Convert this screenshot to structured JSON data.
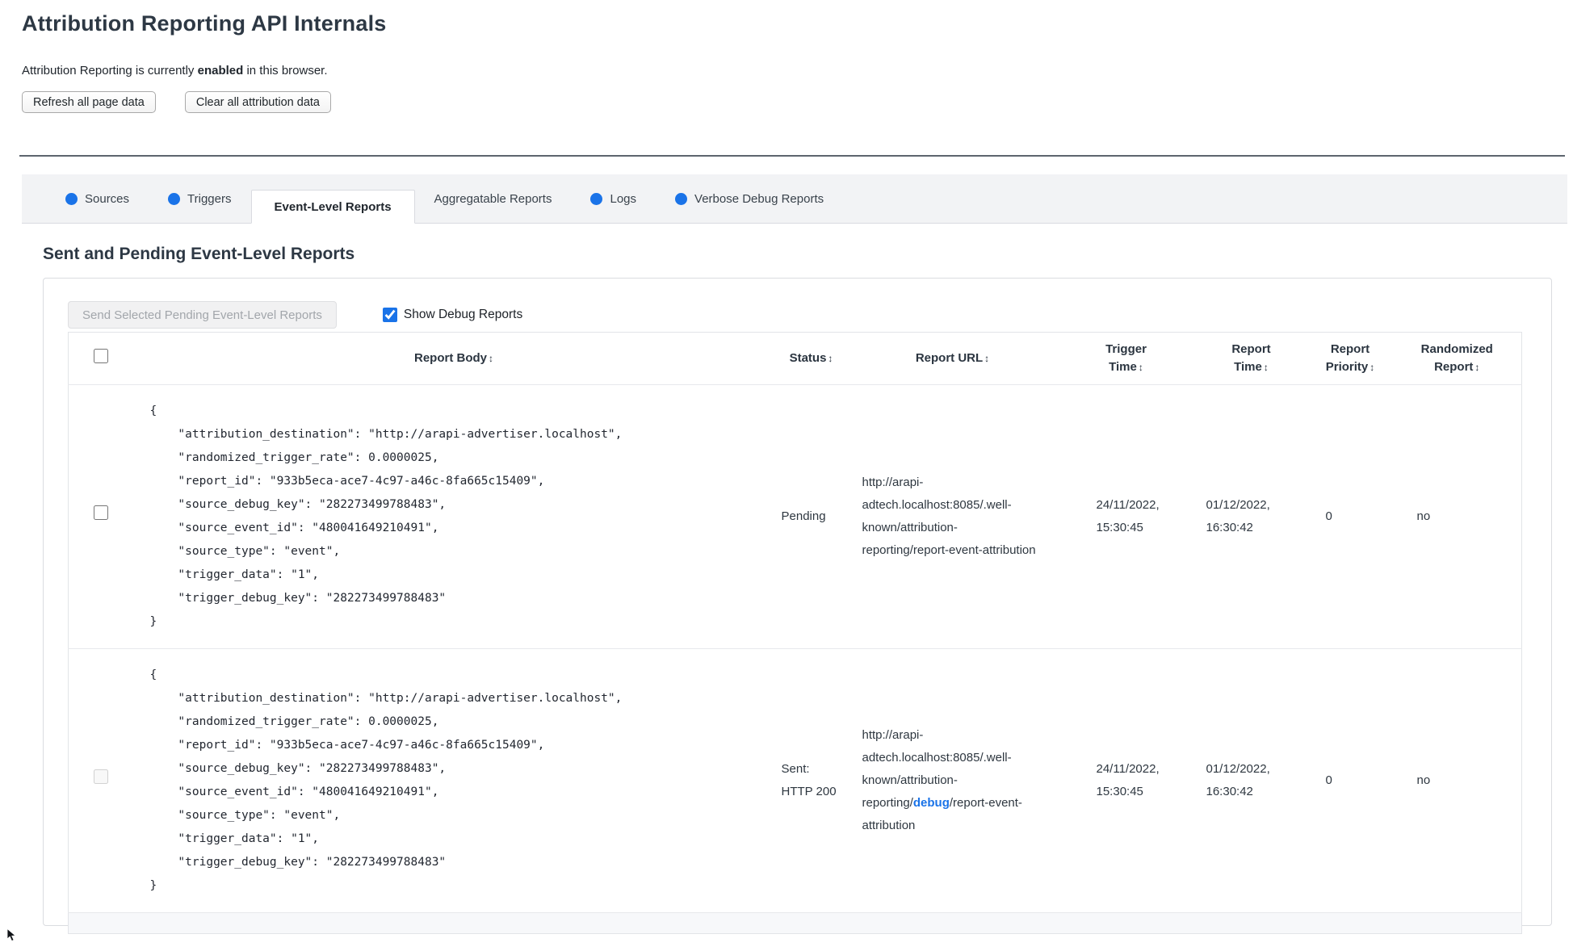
{
  "page": {
    "title": "Attribution Reporting API Internals",
    "status_prefix": "Attribution Reporting is currently ",
    "status_highlight": "enabled",
    "status_suffix": " in this browser.",
    "refresh_button": "Refresh all page data",
    "clear_button": "Clear all attribution data"
  },
  "tabs": [
    {
      "label": "Sources",
      "dot": true,
      "selected": false
    },
    {
      "label": "Triggers",
      "dot": true,
      "selected": false
    },
    {
      "label": "Event-Level Reports",
      "dot": false,
      "selected": true
    },
    {
      "label": "Aggregatable Reports",
      "dot": false,
      "selected": false
    },
    {
      "label": "Logs",
      "dot": true,
      "selected": false
    },
    {
      "label": "Verbose Debug Reports",
      "dot": true,
      "selected": false
    }
  ],
  "section": {
    "heading": "Sent and Pending Event-Level Reports",
    "send_button": "Send Selected Pending Event-Level Reports",
    "show_debug_label": "Show Debug Reports",
    "show_debug_checked": true
  },
  "table": {
    "sort_icon": "↕",
    "headers": [
      "Report Body",
      "Status",
      "Report URL",
      "Trigger Time",
      "Report Time",
      "Report Priority",
      "Randomized Report"
    ],
    "rows": [
      {
        "selectable": true,
        "report_body": "{\n    \"attribution_destination\": \"http://arapi-advertiser.localhost\",\n    \"randomized_trigger_rate\": 0.0000025,\n    \"report_id\": \"933b5eca-ace7-4c97-a46c-8fa665c15409\",\n    \"source_debug_key\": \"282273499788483\",\n    \"source_event_id\": \"480041649210491\",\n    \"source_type\": \"event\",\n    \"trigger_data\": \"1\",\n    \"trigger_debug_key\": \"282273499788483\"\n}",
        "status": "Pending",
        "url_prefix": "http://arapi-adtech.localhost:8085/.well-known/attribution-reporting/report-event-attribution",
        "url_link": "",
        "url_suffix": "",
        "trigger_time": "24/11/2022, 15:30:45",
        "report_time": "01/12/2022, 16:30:42",
        "priority": "0",
        "randomized": "no"
      },
      {
        "selectable": false,
        "report_body": "{\n    \"attribution_destination\": \"http://arapi-advertiser.localhost\",\n    \"randomized_trigger_rate\": 0.0000025,\n    \"report_id\": \"933b5eca-ace7-4c97-a46c-8fa665c15409\",\n    \"source_debug_key\": \"282273499788483\",\n    \"source_event_id\": \"480041649210491\",\n    \"source_type\": \"event\",\n    \"trigger_data\": \"1\",\n    \"trigger_debug_key\": \"282273499788483\"\n}",
        "status": "Sent: HTTP 200",
        "url_prefix": "http://arapi-adtech.localhost:8085/.well-known/attribution-reporting/",
        "url_link": "debug",
        "url_suffix": "/report-event-attribution",
        "trigger_time": "24/11/2022, 15:30:45",
        "report_time": "01/12/2022, 16:30:42",
        "priority": "0",
        "randomized": "no"
      }
    ]
  },
  "colors": {
    "accent_blue": "#1a73e8"
  }
}
